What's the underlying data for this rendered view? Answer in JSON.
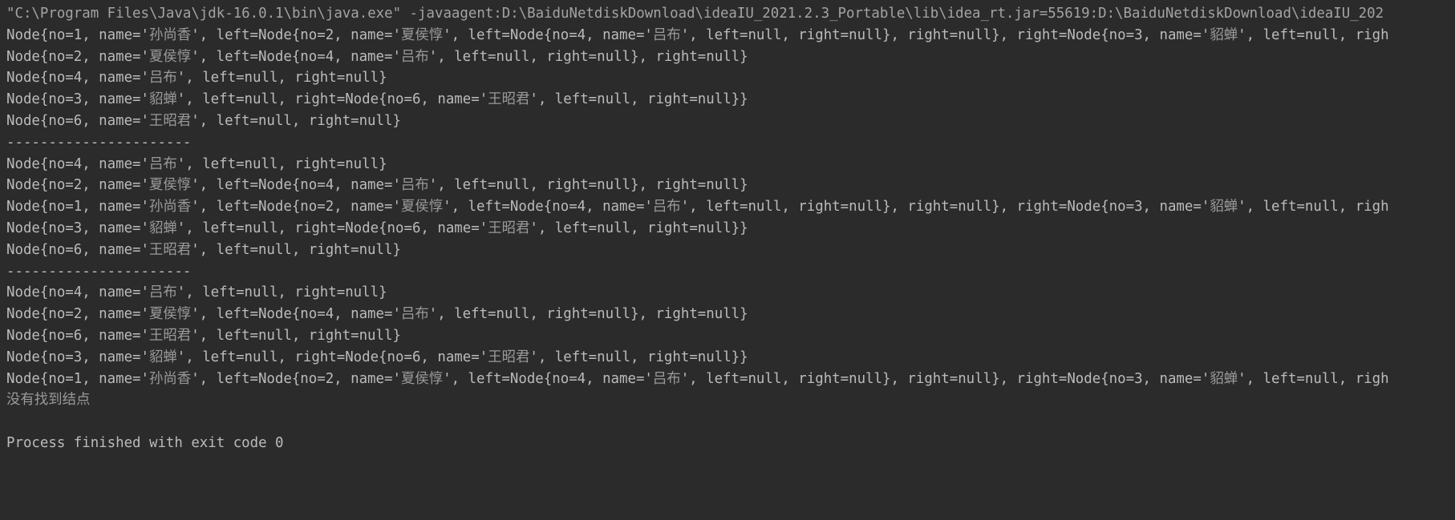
{
  "window": {
    "app": "IntelliJ IDEA",
    "panel_name": "Run console",
    "theme": "Darcula",
    "background_color": "#2b2b2b",
    "text_color": "#bbbbbb",
    "command_text_color": "#a3a3a3"
  },
  "console": {
    "command_line": "\"C:\\Program Files\\Java\\jdk-16.0.1\\bin\\java.exe\" -javaagent:D:\\BaiduNetdiskDownload\\ideaIU_2021.2.3_Portable\\lib\\idea_rt.jar=55619:D:\\BaiduNetdiskDownload\\ideaIU_202",
    "separator": "----------------------",
    "not_found_message": "没有找到结点",
    "status_line": "Process finished with exit code 0",
    "exit_code": "0",
    "lines": [
      {
        "kind": "command",
        "text": "\"C:\\Program Files\\Java\\jdk-16.0.1\\bin\\java.exe\" -javaagent:D:\\BaiduNetdiskDownload\\ideaIU_2021.2.3_Portable\\lib\\idea_rt.jar=55619:D:\\BaiduNetdiskDownload\\ideaIU_202"
      },
      {
        "kind": "stdout",
        "text": "Node{no=1, name='孙尚香', left=Node{no=2, name='夏侯惇', left=Node{no=4, name='吕布', left=null, right=null}, right=null}, right=Node{no=3, name='貂蝉', left=null, righ"
      },
      {
        "kind": "stdout",
        "text": "Node{no=2, name='夏侯惇', left=Node{no=4, name='吕布', left=null, right=null}, right=null}"
      },
      {
        "kind": "stdout",
        "text": "Node{no=4, name='吕布', left=null, right=null}"
      },
      {
        "kind": "stdout",
        "text": "Node{no=3, name='貂蝉', left=null, right=Node{no=6, name='王昭君', left=null, right=null}}"
      },
      {
        "kind": "stdout",
        "text": "Node{no=6, name='王昭君', left=null, right=null}"
      },
      {
        "kind": "separator",
        "text": "----------------------"
      },
      {
        "kind": "stdout",
        "text": "Node{no=4, name='吕布', left=null, right=null}"
      },
      {
        "kind": "stdout",
        "text": "Node{no=2, name='夏侯惇', left=Node{no=4, name='吕布', left=null, right=null}, right=null}"
      },
      {
        "kind": "stdout",
        "text": "Node{no=1, name='孙尚香', left=Node{no=2, name='夏侯惇', left=Node{no=4, name='吕布', left=null, right=null}, right=null}, right=Node{no=3, name='貂蝉', left=null, righ"
      },
      {
        "kind": "stdout",
        "text": "Node{no=3, name='貂蝉', left=null, right=Node{no=6, name='王昭君', left=null, right=null}}"
      },
      {
        "kind": "stdout",
        "text": "Node{no=6, name='王昭君', left=null, right=null}"
      },
      {
        "kind": "separator",
        "text": "----------------------"
      },
      {
        "kind": "stdout",
        "text": "Node{no=4, name='吕布', left=null, right=null}"
      },
      {
        "kind": "stdout",
        "text": "Node{no=2, name='夏侯惇', left=Node{no=4, name='吕布', left=null, right=null}, right=null}"
      },
      {
        "kind": "stdout",
        "text": "Node{no=6, name='王昭君', left=null, right=null}"
      },
      {
        "kind": "stdout",
        "text": "Node{no=3, name='貂蝉', left=null, right=Node{no=6, name='王昭君', left=null, right=null}}"
      },
      {
        "kind": "stdout",
        "text": "Node{no=1, name='孙尚香', left=Node{no=2, name='夏侯惇', left=Node{no=4, name='吕布', left=null, right=null}, right=null}, right=Node{no=3, name='貂蝉', left=null, righ"
      },
      {
        "kind": "stdout",
        "text": "没有找到结点"
      },
      {
        "kind": "blank",
        "text": ""
      },
      {
        "kind": "status",
        "text": "Process finished with exit code 0"
      }
    ]
  }
}
